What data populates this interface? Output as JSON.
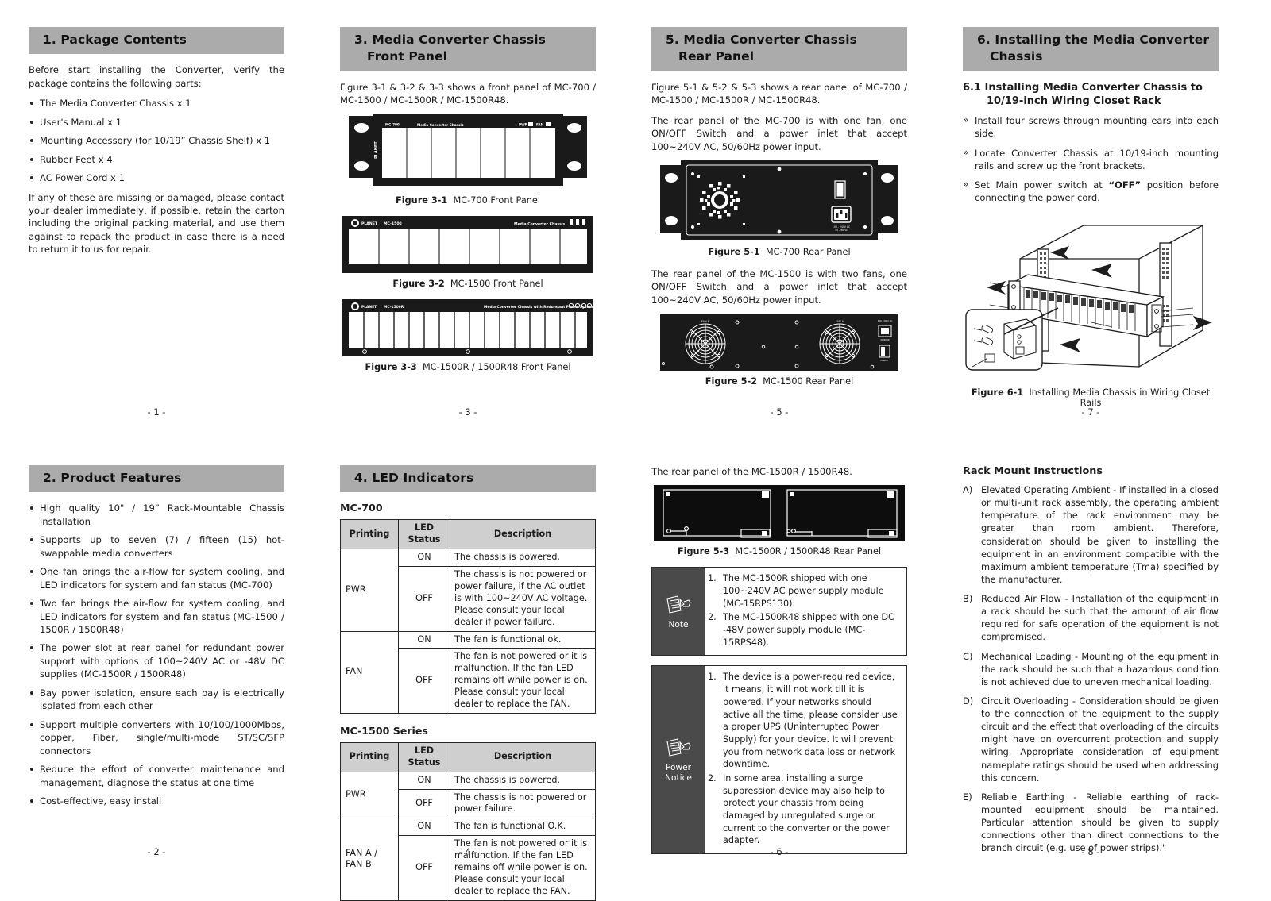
{
  "doc": {
    "colors": {
      "header_bar": "#ababab",
      "note_icon_bg": "#4a4a4a",
      "table_header": "#cfcfcf",
      "device_body": "#1a1a1a"
    }
  },
  "pages": {
    "p1": "- 1 -",
    "p2": "- 2 -",
    "p3": "- 3 -",
    "p4": "- 4 -",
    "p5": "- 5 -",
    "p6": "- 6 -",
    "p7": "- 7 -",
    "p8": "- 8 -"
  },
  "sec1": {
    "title": "1. Package Contents",
    "intro": "Before start installing the Converter, verify the package contains the following parts:",
    "items": [
      "The Media Converter Chassis x 1",
      "User's Manual x 1",
      "Mounting Accessory (for 10/19” Chassis Shelf) x 1",
      "Rubber Feet x 4",
      "AC Power Cord x 1"
    ],
    "outro": "If any of these are missing or damaged, please contact your dealer immediately, if possible, retain the carton including the original packing material, and use them against to repack the product in case there is a need to return it to us for repair."
  },
  "sec2": {
    "title": "2.  Product Features",
    "items": [
      "High quality 10\" / 19” Rack-Mountable Chassis installation",
      "Supports up to seven (7) / fifteen (15) hot-swappable media converters",
      "One fan brings the air-flow for system cooling, and LED indicators for system and fan status (MC-700)",
      "Two fan brings the air-flow for system cooling, and LED indicators for system and fan status (MC-1500 / 1500R / 1500R48)",
      "The power slot at rear panel for redundant power support with options of 100~240V AC or -48V DC supplies (MC-1500R / 1500R48)",
      "Bay power isolation, ensure each bay is electrically isolated from each other",
      "Support multiple converters with 10/100/1000Mbps, copper, Fiber, single/multi-mode ST/SC/SFP connectors",
      "Reduce the effort of converter maintenance and management, diagnose the status at one time",
      "Cost-effective, easy install"
    ]
  },
  "sec3": {
    "title_l1": "3.  Media Converter Chassis",
    "title_l2": "Front Panel",
    "intro": "Figure 3-1 & 3-2 & 3-3 shows a front panel of MC-700 / MC-1500 / MC-1500R / MC-1500R48.",
    "fig31_label": "Figure 3-1",
    "fig31_text": "MC-700 Front Panel",
    "fig32_label": "Figure 3-2",
    "fig32_text": "MC-1500 Front Panel",
    "fig33_label": "Figure 3-3",
    "fig33_text": "MC-1500R / 1500R48 Front Panel",
    "panel_brand": "PLANET",
    "panel_model_700": "MC-700",
    "panel_title_700": "Media Converter Chassis",
    "panel_led_pwr": "PWR",
    "panel_led_fan": "FAN",
    "panel_model_1500": "MC-1500",
    "panel_title_1500": "Media Converter Chassis",
    "panel_model_1500r": "MC-1500R",
    "panel_title_1500r": "Media Converter Chassis with Redundant Power System"
  },
  "sec4": {
    "title": "4.  LED Indicators",
    "t1_title": "MC-700",
    "t2_title": "MC-1500 Series",
    "columns": [
      "Printing",
      "LED Status",
      "Description"
    ],
    "columns_display": {
      "c1": "Printing",
      "c2a": "LED",
      "c2b": "Status",
      "c3": "Description"
    },
    "table_mc700": [
      {
        "printing": "PWR",
        "rows": [
          {
            "status": "ON",
            "desc": "The chassis is powered."
          },
          {
            "status": "OFF",
            "desc": "The chassis is not powered or power failure, if the AC outlet is with 100~240V AC voltage. Please consult your local dealer if power failure."
          }
        ]
      },
      {
        "printing": "FAN",
        "rows": [
          {
            "status": "ON",
            "desc": "The fan is functional ok."
          },
          {
            "status": "OFF",
            "desc": "The fan is not powered or it is malfunction. If the fan LED remains off while power is on. Please consult your local dealer to replace the FAN."
          }
        ]
      }
    ],
    "table_mc1500": [
      {
        "printing": "PWR",
        "rows": [
          {
            "status": "ON",
            "desc": "The chassis is powered."
          },
          {
            "status": "OFF",
            "desc": "The chassis is not powered or power failure."
          }
        ]
      },
      {
        "printing": "FAN A / FAN B",
        "rows": [
          {
            "status": "ON",
            "desc": "The fan is functional O.K."
          },
          {
            "status": "OFF",
            "desc": "The fan is not powered or it is malfunction. If the fan LED remains off while power is on. Please consult your local dealer to replace the FAN."
          }
        ]
      }
    ]
  },
  "sec5": {
    "title_l1": "5.  Media Converter Chassis",
    "title_l2": "Rear Panel",
    "intro": "Figure 5-1 & 5-2 & 5-3 shows a rear panel of MC-700 / MC-1500 / MC-1500R / MC-1500R48.",
    "p700": "The rear panel of the MC-700 is with one fan, one ON/OFF Switch and a power inlet that accept 100~240V AC, 50/60Hz power input.",
    "p1500": "The rear panel of the MC-1500 is with two fans, one ON/OFF Switch and a power inlet that accept 100~240V AC, 50/60Hz power input.",
    "p1500r": "The rear panel of the MC-1500R / 1500R48.",
    "fig51_label": "Figure 5-1",
    "fig51_text": "MC-700 Rear Panel",
    "fig52_label": "Figure 5-2",
    "fig52_text": "MC-1500 Rear Panel",
    "fig53_label": "Figure 5-3",
    "fig53_text": "MC-1500R / 1500R48 Rear Panel",
    "rear_ac_label": "100 - 240V AC\n50 - 60HZ",
    "rear_fan_a": "FAN A",
    "rear_fan_b": "FAN B",
    "note": {
      "label": "Note",
      "items": [
        "The MC-1500R shipped with one 100~240V AC power supply module (MC-15RPS130).",
        "The MC-1500R48 shipped with one DC -48V power supply module (MC-15RPS48)."
      ]
    },
    "power_notice": {
      "label_l1": "Power",
      "label_l2": "Notice",
      "items": [
        "The device is a power-required device, it means, it will not work till it is powered. If your networks should active all the time, please consider use a proper UPS (Uninterrupted Power Supply) for your device. It will prevent you from network data loss or network downtime.",
        "In some area, installing a surge suppression device may also help to protect your chassis from being damaged by unregulated surge or current to the converter or the power adapter."
      ]
    }
  },
  "sec6": {
    "title_l1": "6.  Installing the Media Converter",
    "title_l2": "Chassis",
    "sub_l1": "6.1 Installing  Media  Converter  Chassis  to",
    "sub_l2": "10/19-inch Wiring Closet Rack",
    "steps": [
      "Install four screws through mounting ears into each side.",
      "Locate Converter Chassis at 10/19-inch mounting rails and screw up the front brackets.",
      "Set Main power switch at “OFF” position before connecting the power cord."
    ],
    "step3_pre": "Set  Main  power  switch  at  ",
    "step3_bold": "“OFF”",
    "step3_post": "  position  before connecting the power cord.",
    "fig61_label": "Figure 6-1",
    "fig61_text": "Installing Media Chassis in Wiring Closet Rails"
  },
  "sec7": {
    "title": "Rack Mount Instructions",
    "items": [
      {
        "letter": "A)",
        "text": "Elevated Operating Ambient - If installed in a closed or multi-unit rack assembly, the operating ambient temperature of the rack environment may be greater than room ambient. Therefore, consideration should be given to installing the equipment in an environment compatible with the maximum ambient temperature (Tma) specified by the manufacturer."
      },
      {
        "letter": "B)",
        "text": "Reduced Air Flow - Installation of the equipment in a rack should be such that the amount of air flow required for safe operation of the equipment is not compromised."
      },
      {
        "letter": "C)",
        "text": "Mechanical Loading - Mounting of the equipment in the rack should be such that a hazardous condition is not achieved due to uneven mechanical loading."
      },
      {
        "letter": "D)",
        "text": "Circuit Overloading - Consideration should be given to the connection of the equipment to the supply circuit and the effect that overloading of the circuits might have on overcurrent protection and supply wiring. Appropriate consideration of equipment nameplate ratings should be used when addressing this concern."
      },
      {
        "letter": "E)",
        "text": "Reliable Earthing - Reliable earthing of rack-mounted equipment should be maintained. Particular attention should be given to supply connections other than direct connections to the branch circuit (e.g. use of power strips).\""
      }
    ]
  }
}
